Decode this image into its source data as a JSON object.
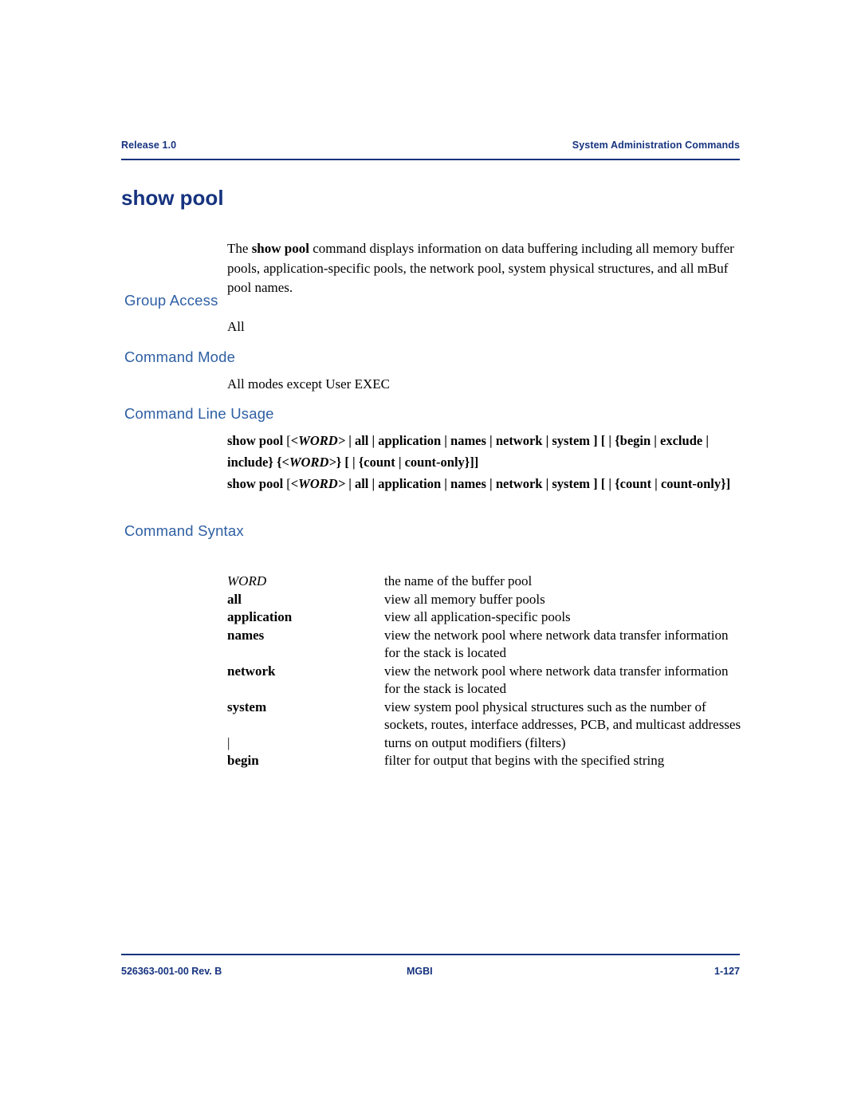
{
  "header": {
    "left": "Release 1.0",
    "right": "System Administration Commands"
  },
  "title": "show pool",
  "intro": {
    "pre": "The ",
    "bold": "show pool",
    "post": " command displays information on data buffering including all memory buffer pools, application-specific pools, the network pool, system physical structures, and all mBuf pool names."
  },
  "sections": {
    "group_access": {
      "heading": "Group Access",
      "body": "All"
    },
    "command_mode": {
      "heading": "Command Mode",
      "body": "All modes except User EXEC"
    },
    "command_line_usage": {
      "heading": "Command Line Usage",
      "line1": "show  pool  [<WORD> | all | application | names | network | system ]  [ | {begin | exclude | include} {<WORD>} [ | {count | count-only}]]",
      "line1_parts": {
        "a": "show  pool  ",
        "b": "[",
        "c": "<WORD>",
        "d": " | all | application | names | network | system ]  [ | {begin | exclude | include} {",
        "e": "<WORD>",
        "f": "} [ | {count | count-only}]]"
      },
      "line2_parts": {
        "a": "show  pool  ",
        "b": "[",
        "c": "<WORD>",
        "d": " | all | application | names | network | system ]  [ | {count | count-only}]"
      }
    },
    "command_syntax": {
      "heading": "Command Syntax",
      "rows": [
        {
          "term": "WORD",
          "style": "italic",
          "desc": "the name of the buffer pool"
        },
        {
          "term": "all",
          "style": "bold",
          "desc": "view all memory buffer pools"
        },
        {
          "term": "application",
          "style": "bold",
          "desc": "view all application-specific pools"
        },
        {
          "term": "names",
          "style": "bold",
          "desc": "view the network pool where network data transfer information for the stack is located"
        },
        {
          "term": "network",
          "style": "bold",
          "desc": "view the network pool where network data transfer information for the stack is located"
        },
        {
          "term": "system",
          "style": "bold",
          "desc": "view system pool physical structures such as the number of sockets, routes, interface addresses, PCB, and multicast addresses"
        },
        {
          "term": "|",
          "style": "plain",
          "desc": "turns on output modifiers (filters)"
        },
        {
          "term": "begin",
          "style": "bold",
          "desc": "filter for output that begins with the specified string"
        }
      ]
    }
  },
  "footer": {
    "left": "526363-001-00 Rev. B",
    "middle": "MGBI",
    "right": "1-127"
  },
  "colors": {
    "heading_blue": "#16337f",
    "subheading_blue": "#2e5fa3"
  }
}
